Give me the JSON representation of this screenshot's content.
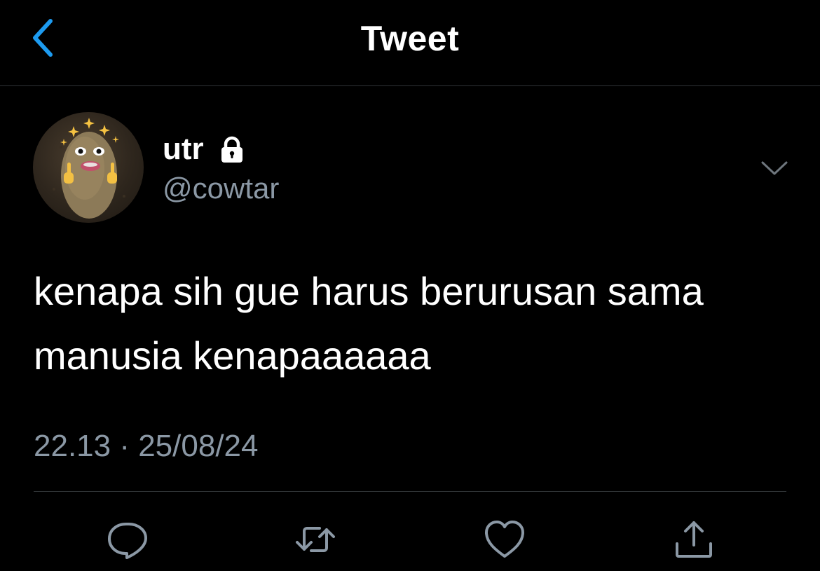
{
  "header": {
    "title": "Tweet",
    "back_icon": "chevron-left-icon"
  },
  "author": {
    "display_name": "utr",
    "handle": "@cowtar",
    "protected_icon": "lock-icon",
    "avatar_icon": "potato-avatar"
  },
  "tweet": {
    "text": "kenapa sih gue harus berurusan sama manusia kenapaaaaaa",
    "timestamp": "22.13 · 25/08/24"
  },
  "actions": {
    "reply_icon": "reply-icon",
    "retweet_icon": "retweet-icon",
    "like_icon": "heart-icon",
    "share_icon": "share-icon"
  },
  "colors": {
    "background": "#000000",
    "text": "#ffffff",
    "secondary_text": "#8b98a5",
    "accent": "#1d9bf0",
    "divider": "#2f3336"
  }
}
